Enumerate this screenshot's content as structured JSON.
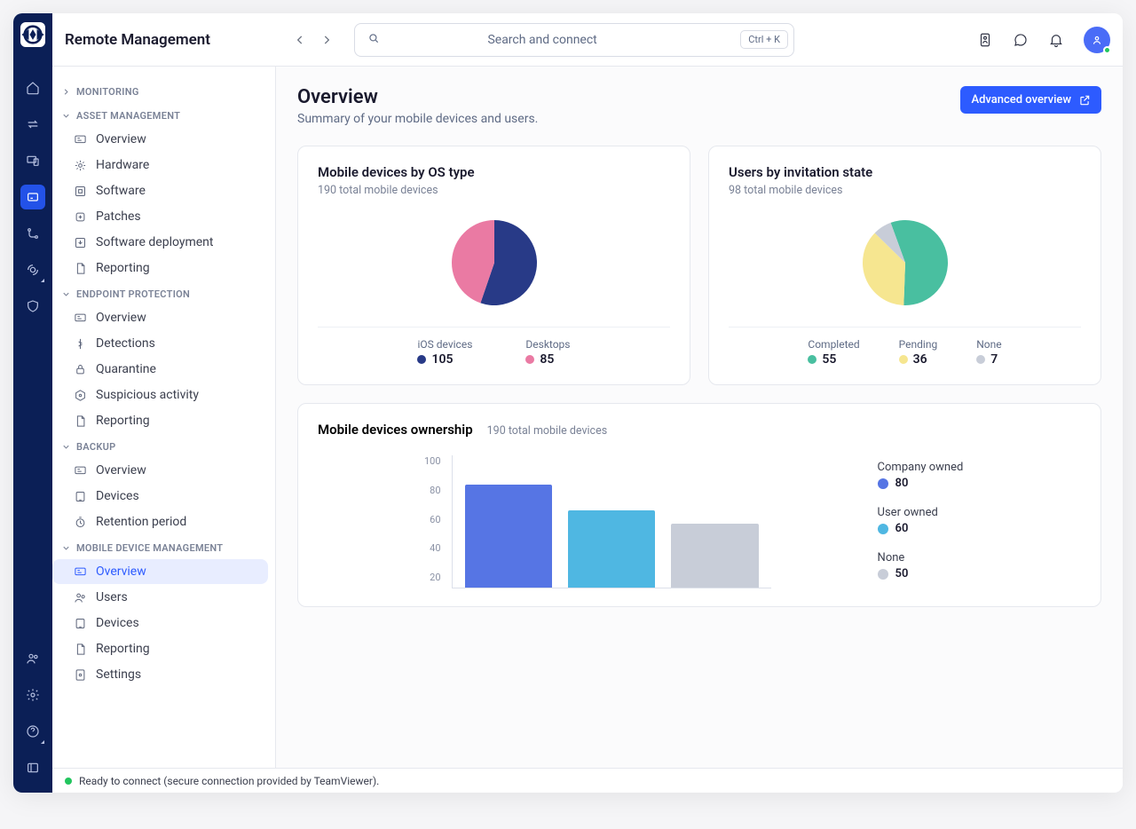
{
  "app_title": "Remote Management",
  "search": {
    "placeholder": "Search and connect",
    "kbd": "Ctrl + K"
  },
  "sidebar": {
    "groups": [
      {
        "label": "MONITORING",
        "collapsed": true
      },
      {
        "label": "ASSET MANAGEMENT",
        "items": [
          "Overview",
          "Hardware",
          "Software",
          "Patches",
          "Software deployment",
          "Reporting"
        ]
      },
      {
        "label": "ENDPOINT PROTECTION",
        "items": [
          "Overview",
          "Detections",
          "Quarantine",
          "Suspicious activity",
          "Reporting"
        ]
      },
      {
        "label": "BACKUP",
        "items": [
          "Overview",
          "Devices",
          "Retention period"
        ]
      },
      {
        "label": "MOBILE DEVICE MANAGEMENT",
        "items": [
          "Overview",
          "Users",
          "Devices",
          "Reporting",
          "Settings"
        ],
        "active": 0
      }
    ]
  },
  "page": {
    "title": "Overview",
    "subtitle": "Summary of your mobile devices and users.",
    "advanced_btn": "Advanced overview"
  },
  "card1": {
    "title": "Mobile devices by OS type",
    "sub": "190 total mobile devices",
    "legend": [
      {
        "label": "iOS devices",
        "value": "105"
      },
      {
        "label": "Desktops",
        "value": "85"
      }
    ]
  },
  "card2": {
    "title": "Users by invitation state",
    "sub": "98 total mobile devices",
    "legend": [
      {
        "label": "Completed",
        "value": "55"
      },
      {
        "label": "Pending",
        "value": "36"
      },
      {
        "label": "None",
        "value": "7"
      }
    ]
  },
  "card3": {
    "title": "Mobile devices ownership",
    "sub": "190 total mobile devices",
    "legend": [
      {
        "label": "Company owned",
        "value": "80"
      },
      {
        "label": "User owned",
        "value": "60"
      },
      {
        "label": "None",
        "value": "50"
      }
    ],
    "yticks": [
      "100",
      "80",
      "60",
      "40",
      "20"
    ]
  },
  "status": "Ready to connect (secure connection provided by TeamViewer).",
  "colors": {
    "navy": "#283a87",
    "pink": "#ea7aa3",
    "teal": "#49bfa0",
    "yellow": "#f6e690",
    "grey": "#c8cdd8",
    "blue": "#5675e4",
    "cyan": "#4fb7e2"
  },
  "chart_data": [
    {
      "type": "pie",
      "title": "Mobile devices by OS type",
      "series": [
        {
          "name": "iOS devices",
          "value": 105
        },
        {
          "name": "Desktops",
          "value": 85
        }
      ]
    },
    {
      "type": "pie",
      "title": "Users by invitation state",
      "series": [
        {
          "name": "Completed",
          "value": 55
        },
        {
          "name": "Pending",
          "value": 36
        },
        {
          "name": "None",
          "value": 7
        }
      ]
    },
    {
      "type": "bar",
      "title": "Mobile devices ownership",
      "categories": [
        "Company owned",
        "User owned",
        "None"
      ],
      "values": [
        80,
        60,
        50
      ],
      "ylim": [
        0,
        100
      ],
      "ylabel": ""
    }
  ]
}
